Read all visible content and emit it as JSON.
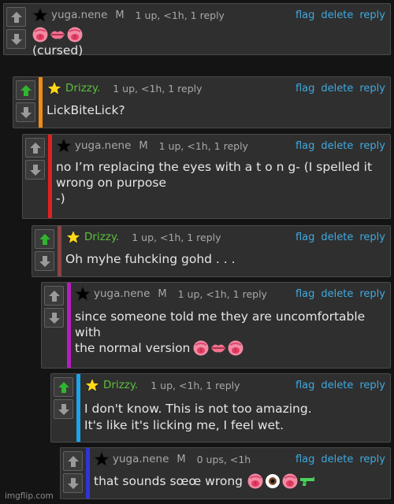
{
  "actions": {
    "flag": "flag",
    "delete": "delete",
    "reply": "reply"
  },
  "comments": [
    {
      "user": "yuga.nene",
      "mod": "M",
      "meta": "1 up, <1h, 1 reply",
      "lines": [
        "",
        "(cursed)"
      ],
      "star_color": "#000000",
      "bar_color": null,
      "up_active": false
    },
    {
      "user": "Drizzy.",
      "mod": "",
      "meta": "1 up, <1h, 1 reply",
      "lines": [
        "LickBiteLick?"
      ],
      "star_color": "#ffd81a",
      "bar_color": "#f28c10",
      "up_active": true
    },
    {
      "user": "yuga.nene",
      "mod": "M",
      "meta": "1 up, <1h, 1 reply",
      "lines": [
        "no I’m replacing the eyes with a t o n g- (I spelled it",
        "wrong on purpose",
        "-)"
      ],
      "star_color": "#000000",
      "bar_color": "#e02020",
      "up_active": false
    },
    {
      "user": "Drizzy.",
      "mod": "",
      "meta": "1 up, <1h, 1 reply",
      "lines": [
        "Oh myhe fuhcking gohd . . ."
      ],
      "star_color": "#ffd81a",
      "bar_color": "#8b4444",
      "up_active": true
    },
    {
      "user": "yuga.nene",
      "mod": "M",
      "meta": "1 up, <1h, 1 reply",
      "lines": [
        "since someone told me they are uncomfortable",
        "with",
        "the normal version"
      ],
      "star_color": "#000000",
      "bar_color": "#b51ec0",
      "up_active": false
    },
    {
      "user": "Drizzy.",
      "mod": "",
      "meta": "1 up, <1h, 1 reply",
      "lines": [
        "I don't know. This is not too amazing.",
        "It's like it's licking me, I feel wet."
      ],
      "star_color": "#ffd81a",
      "bar_color": "#19a4ee",
      "up_active": true
    },
    {
      "user": "yuga.nene",
      "mod": "M",
      "meta": "0 ups, <1h",
      "lines": [
        "that sounds sœœ wrong"
      ],
      "star_color": "#000000",
      "bar_color": "#3232d6",
      "up_active": false
    }
  ],
  "watermark": "imgflip.com",
  "icons": {
    "up": "arrow-up-icon",
    "down": "arrow-down-icon",
    "star": "star-icon",
    "emoji_tongue": "tongue-emoji-icon",
    "emoji_lips": "lips-emoji-icon",
    "emoji_eye": "eye-emoji-icon",
    "emoji_pistol": "water-pistol-emoji-icon"
  },
  "colors": {
    "link": "#3fa9e0",
    "green_user": "#5cbf3c",
    "up_active": "#2fb52f"
  }
}
